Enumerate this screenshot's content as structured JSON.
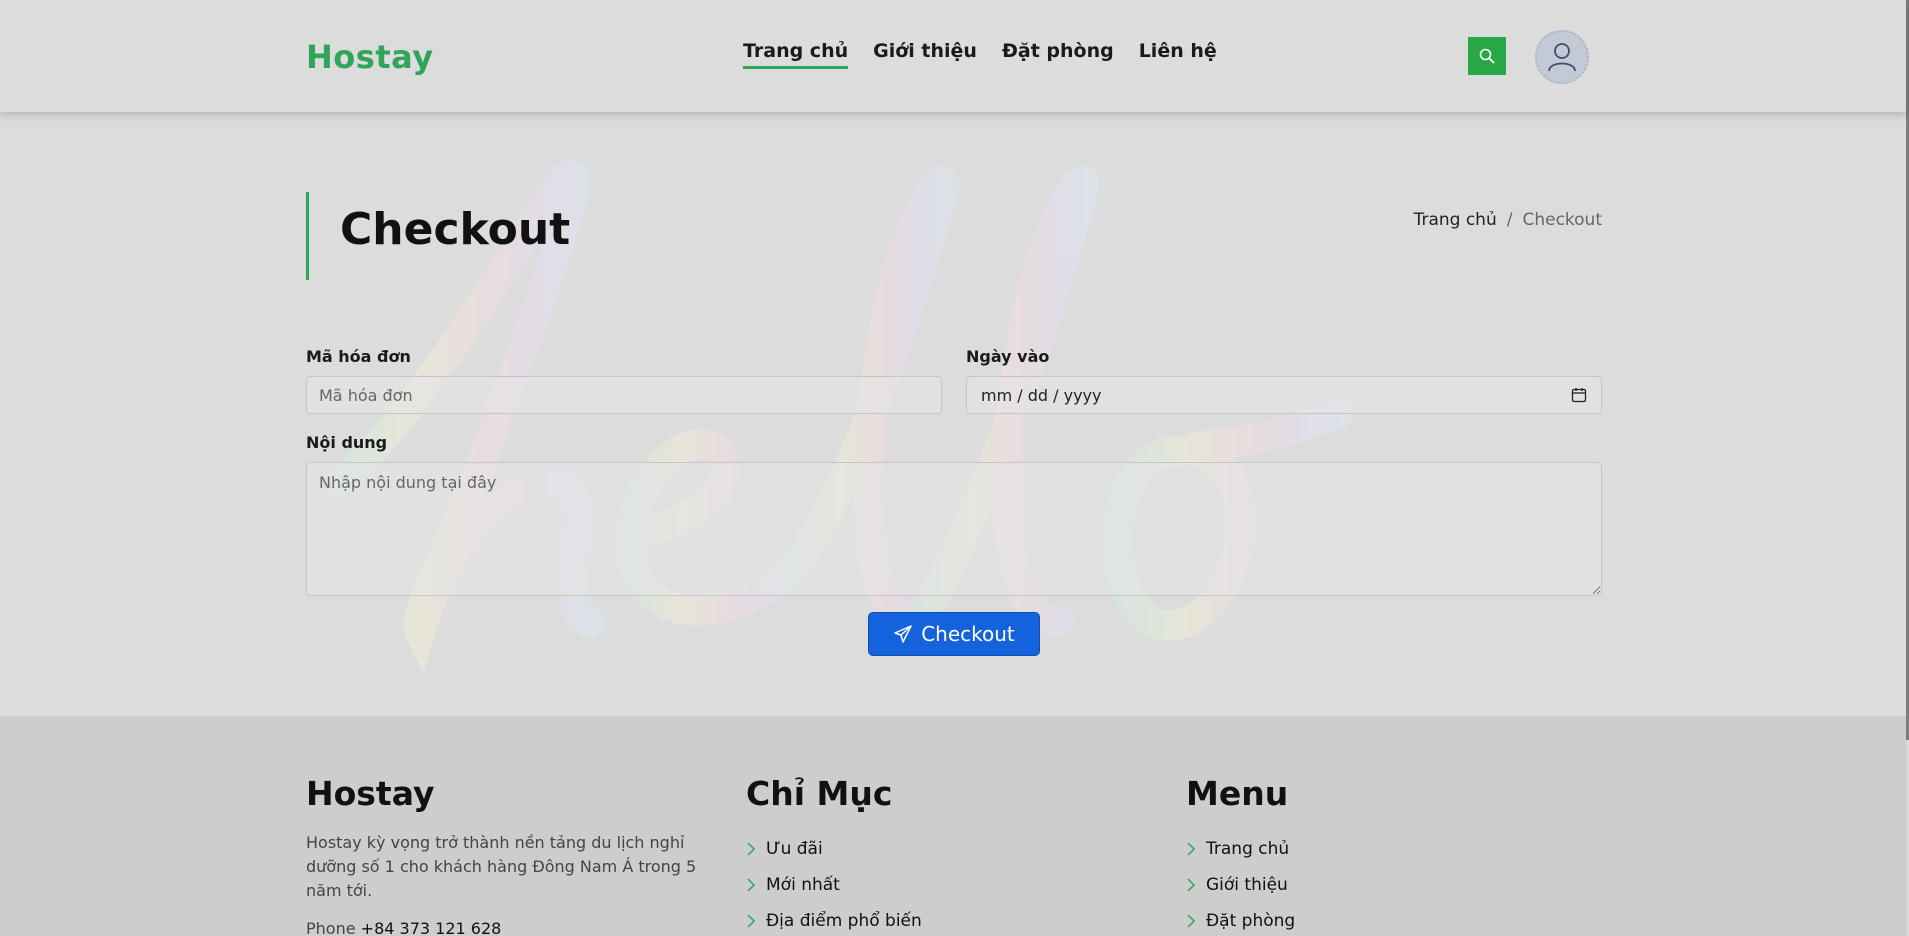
{
  "header": {
    "logo": "Hostay",
    "nav": [
      {
        "label": "Trang chủ",
        "active": true
      },
      {
        "label": "Giới thiệu",
        "active": false
      },
      {
        "label": "Đặt phòng",
        "active": false
      },
      {
        "label": "Liên hệ",
        "active": false
      }
    ],
    "search_icon": "search-icon",
    "avatar_icon": "user-icon"
  },
  "page": {
    "title": "Checkout",
    "breadcrumb": {
      "home": "Trang chủ",
      "separator": "/",
      "current": "Checkout"
    }
  },
  "form": {
    "invoice": {
      "label": "Mã hóa đơn",
      "placeholder": "Mã hóa đơn",
      "value": ""
    },
    "date": {
      "label": "Ngày vào",
      "value": "mm / dd / yyyy",
      "icon": "calendar-icon"
    },
    "content": {
      "label": "Nội dung",
      "placeholder": "Nhập nội dung tại đây",
      "value": ""
    },
    "submit_label": "Checkout",
    "submit_icon": "send-icon"
  },
  "footer": {
    "about": {
      "title": "Hostay",
      "description": "Hostay kỳ vọng trở thành nền tảng du lịch nghỉ dưỡng số 1 cho khách hàng Đông Nam Á trong 5 năm tới.",
      "phone_label": "Phone",
      "phone_value": "+84 373 121 628"
    },
    "index": {
      "title": "Chỉ Mục",
      "items": [
        "Ưu đãi",
        "Mới nhất",
        "Địa điểm phổ biến"
      ]
    },
    "menu": {
      "title": "Menu",
      "items": [
        "Trang chủ",
        "Giới thiệu",
        "Đặt phòng"
      ]
    }
  },
  "colors": {
    "brand": "#2fa55a",
    "primary_button": "#1463dd",
    "search_button": "#28a745"
  }
}
